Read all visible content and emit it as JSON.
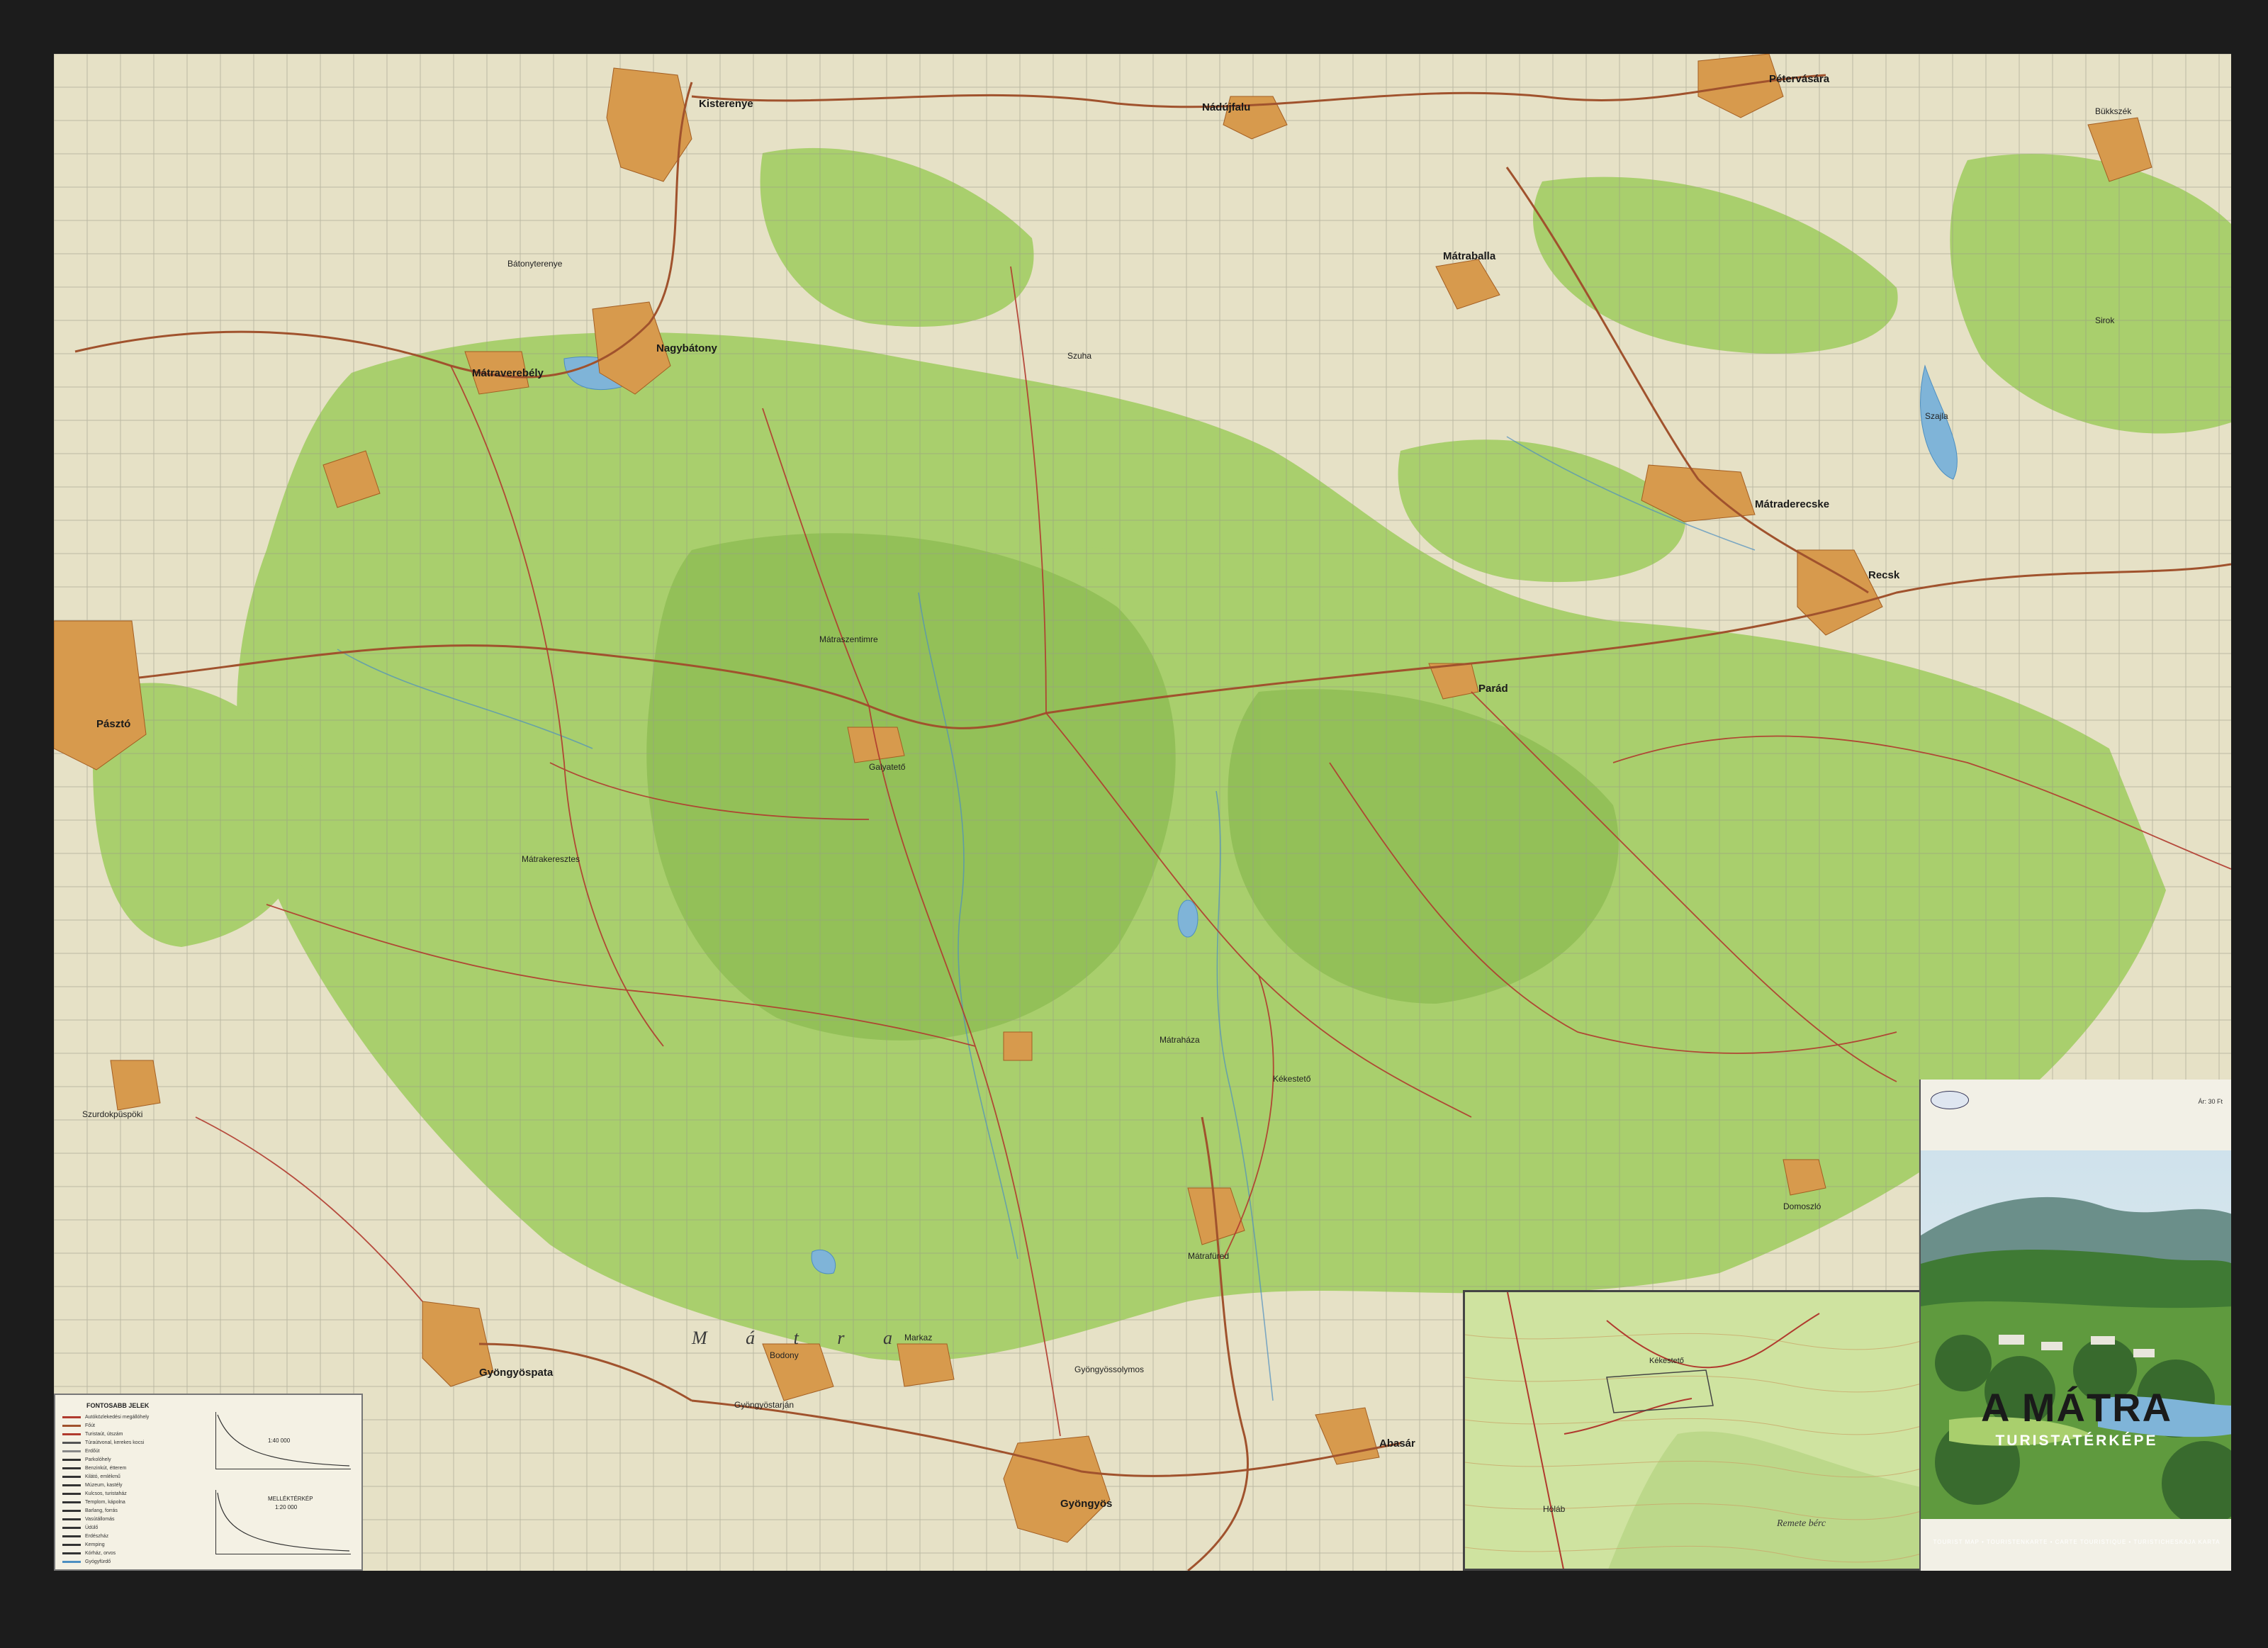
{
  "map": {
    "towns": [
      {
        "name": "Kisterenye"
      },
      {
        "name": "Nádújfalu"
      },
      {
        "name": "Pétervására"
      },
      {
        "name": "Nagybátony"
      },
      {
        "name": "Mátraverebély"
      },
      {
        "name": "Mátraballa"
      },
      {
        "name": "Mátraderecske"
      },
      {
        "name": "Recsk"
      },
      {
        "name": "Pásztó"
      },
      {
        "name": "Parád"
      },
      {
        "name": "Gyöngyös"
      },
      {
        "name": "Gyöngyöspata"
      },
      {
        "name": "Abasár"
      },
      {
        "name": "Mátraszentimre"
      },
      {
        "name": "Mátraháza"
      },
      {
        "name": "Mátrafüred"
      },
      {
        "name": "Bükkszék"
      },
      {
        "name": "Szajla"
      },
      {
        "name": "Domoszló"
      },
      {
        "name": "Markaz"
      },
      {
        "name": "Gyöngyössolymos"
      },
      {
        "name": "Gyöngyöstarján"
      },
      {
        "name": "Szurdokpüspöki"
      },
      {
        "name": "Bodony"
      },
      {
        "name": "Mátrakeresztes"
      },
      {
        "name": "Galyatető"
      },
      {
        "name": "Kékestető"
      },
      {
        "name": "Sirok"
      },
      {
        "name": "Szuha"
      },
      {
        "name": "Bátonyterenye"
      }
    ],
    "range_label": "M á t r a",
    "colors": {
      "forest": "#a9cf6d",
      "forest_dark": "#8fbd55",
      "open": "#e6e1c6",
      "road": "#a0522d",
      "settlement": "#d79a4d",
      "water": "#7fb4d8",
      "grid": "#9a9a8a"
    }
  },
  "legend": {
    "title": "FONTOSABB JELEK",
    "items": [
      "Autóközlekedési megállóhely",
      "Főút",
      "Turistaút, útszám",
      "Túraútvonal, kerekes kocsi",
      "Erdőút",
      "Parkolóhely",
      "Benzinkút, étterem",
      "Kilátó, emlékmű",
      "Múzeum, kastély",
      "Kulcsos, turistaház",
      "Templom, kápolna",
      "Barlang, forrás",
      "Vasútállomás",
      "Üdülő",
      "Erdészház",
      "Kemping",
      "Kórház, orvos",
      "Gyógyfürdő"
    ],
    "scale_label": "1:40 000",
    "profile_label": "MELLÉKTÉRKÉP",
    "profile_scale": "1:20 000"
  },
  "inset": {
    "labels": [
      "Hóláb",
      "Remete bérc",
      "Kékestető"
    ]
  },
  "cover": {
    "code": "Ár: 30 Ft",
    "title": "A MÁTRA",
    "subtitle": "TURISTATÉRKÉPE",
    "footer": "TOURIST MAP • TOURISTENKARTE • CARTE TOURISTIQUE • TURISTICHESKAJA KARTA"
  }
}
